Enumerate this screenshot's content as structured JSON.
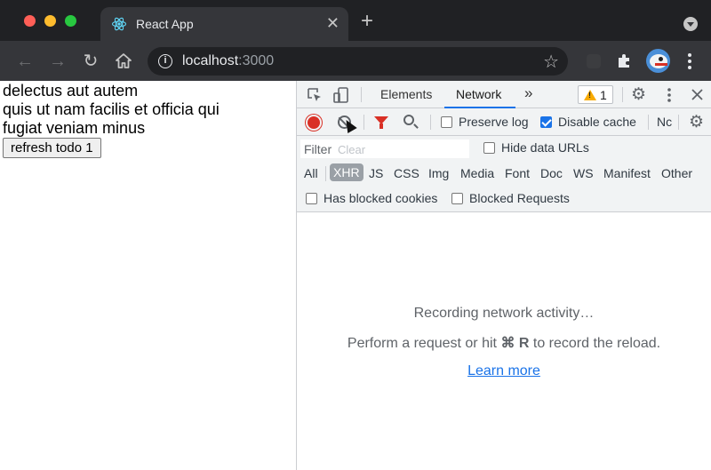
{
  "browser": {
    "tab_title": "React App",
    "tab_close": "✕",
    "new_tab": "+",
    "url_host": "localhost",
    "url_port": ":3000"
  },
  "page": {
    "lines": [
      "delectus aut autem",
      "quis ut nam facilis et officia qui",
      "fugiat veniam minus"
    ],
    "refresh_button": "refresh todo 1"
  },
  "devtools": {
    "tabs": [
      {
        "label": "Elements",
        "active": false
      },
      {
        "label": "Network",
        "active": true
      }
    ],
    "more_tabs": "»",
    "warning_count": "1",
    "toolbar": {
      "preserve_log": "Preserve log",
      "preserve_log_checked": false,
      "disable_cache": "Disable cache",
      "disable_cache_checked": true,
      "throttle": "Nc"
    },
    "filter": {
      "placeholder": "Filter",
      "clear": "Clear",
      "hide_data_urls": "Hide data URLs",
      "hide_data_urls_checked": false
    },
    "types": [
      "All",
      "XHR",
      "JS",
      "CSS",
      "Img",
      "Media",
      "Font",
      "Doc",
      "WS",
      "Manifest",
      "Other"
    ],
    "active_type": "XHR",
    "has_blocked_cookies": "Has blocked cookies",
    "blocked_requests": "Blocked Requests",
    "empty": {
      "recording": "Recording network activity…",
      "perform_prefix": "Perform a request or hit",
      "shortcut": "⌘ R",
      "perform_suffix": "to record the reload.",
      "learn_more": "Learn more"
    }
  }
}
